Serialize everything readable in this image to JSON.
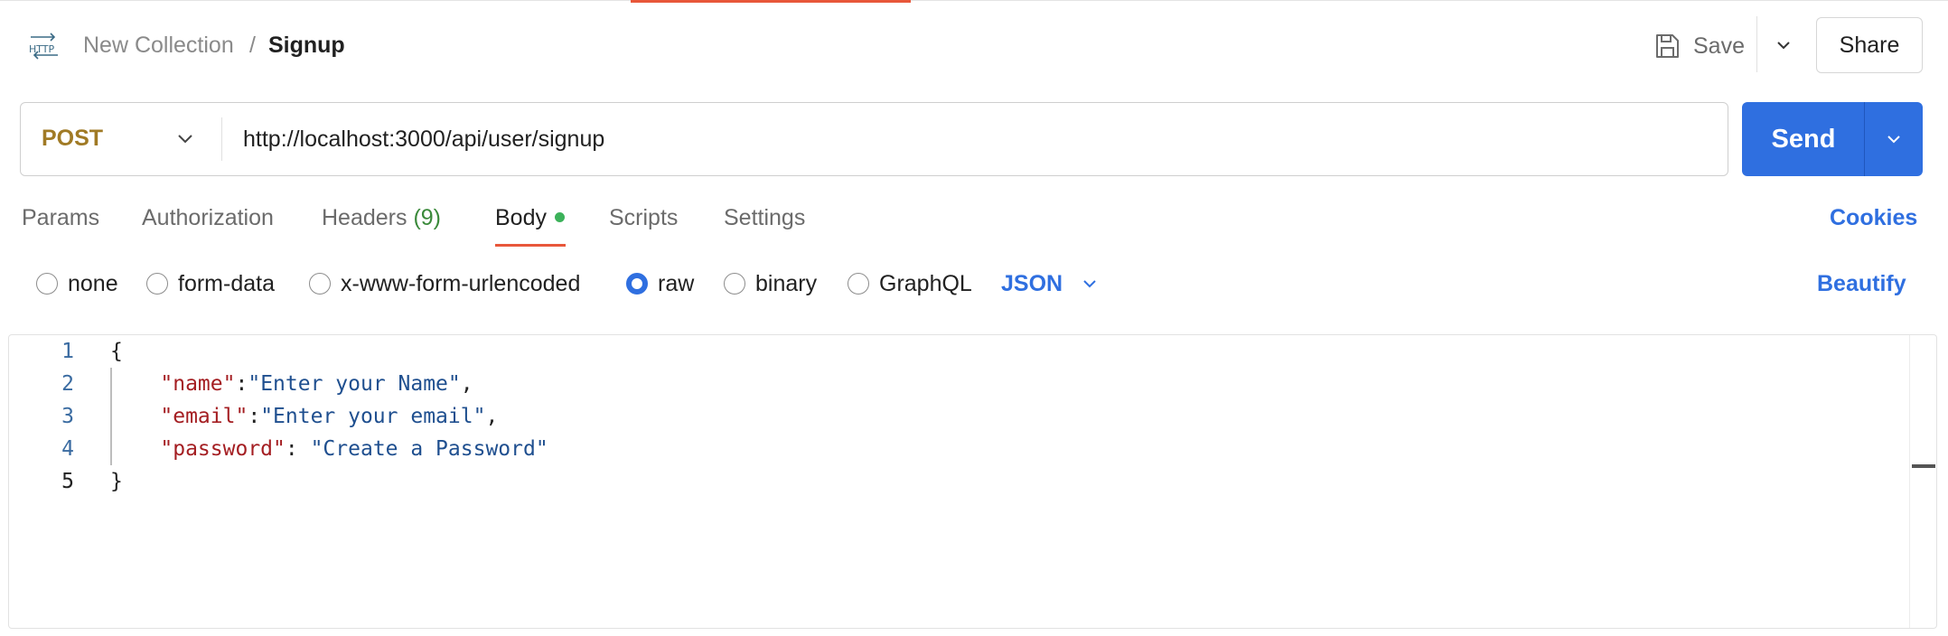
{
  "header": {
    "icon": "http-icon",
    "collection": "New Collection",
    "separator": "/",
    "request_name": "Signup",
    "save_label": "Save",
    "share_label": "Share"
  },
  "request": {
    "method": "POST",
    "url": "http://localhost:3000/api/user/signup",
    "send_label": "Send"
  },
  "tabs": [
    {
      "label": "Params"
    },
    {
      "label": "Authorization"
    },
    {
      "label": "Headers",
      "count": "(9)"
    },
    {
      "label": "Body",
      "active": true
    },
    {
      "label": "Scripts"
    },
    {
      "label": "Settings"
    }
  ],
  "cookies_label": "Cookies",
  "body_types": [
    {
      "label": "none",
      "selected": false
    },
    {
      "label": "form-data",
      "selected": false
    },
    {
      "label": "x-www-form-urlencoded",
      "selected": false
    },
    {
      "label": "raw",
      "selected": true
    },
    {
      "label": "binary",
      "selected": false
    },
    {
      "label": "GraphQL",
      "selected": false
    }
  ],
  "language": "JSON",
  "beautify_label": "Beautify",
  "editor": {
    "line_numbers": [
      "1",
      "2",
      "3",
      "4",
      "5"
    ],
    "open_brace": "{",
    "close_brace": "}",
    "fields": [
      {
        "key": "\"name\"",
        "sep": ":",
        "value": "\"Enter your Name\"",
        "trail": ","
      },
      {
        "key": "\"email\"",
        "sep": ":",
        "value": "\"Enter your email\"",
        "trail": ","
      },
      {
        "key": "\"password\"",
        "sep": ": ",
        "value": "\"Create a Password\"",
        "trail": ""
      }
    ]
  },
  "colors": {
    "accent": "#e8573a",
    "primary": "#2f6fe0",
    "method_post": "#a07a25",
    "json_key": "#a41e22",
    "json_string": "#1f4f8f"
  }
}
